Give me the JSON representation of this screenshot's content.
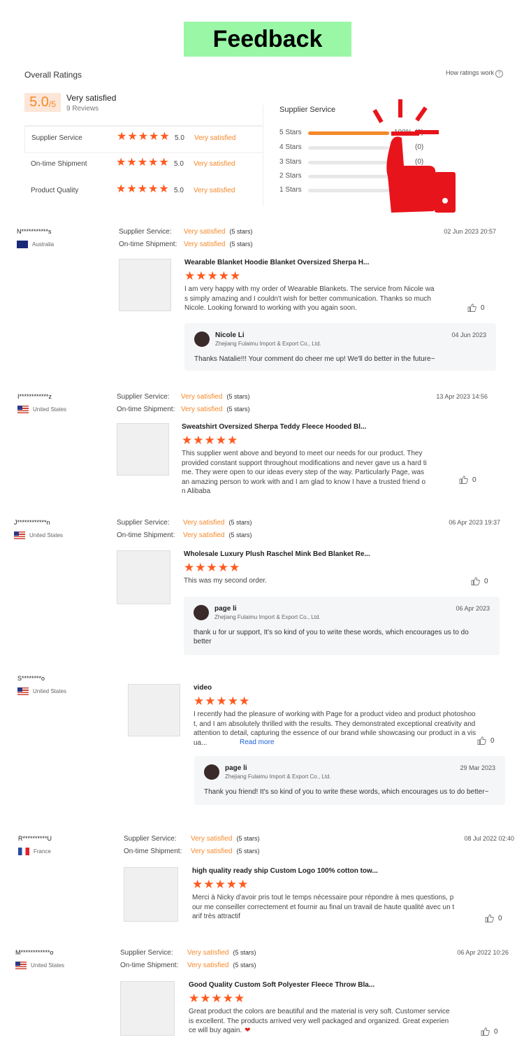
{
  "banner": "Feedback",
  "overall": {
    "title": "Overall Ratings",
    "how_link": "How ratings work",
    "score": "5.0",
    "score_den": "/5",
    "sat_label": "Very satisfied",
    "reviews": "9 Reviews",
    "rows": [
      {
        "label": "Supplier Service",
        "stars": 5,
        "value": "5.0",
        "text": "Very satisfied"
      },
      {
        "label": "On-time Shipment",
        "stars": 5,
        "value": "5.0",
        "text": "Very satisfied"
      },
      {
        "label": "Product Quality",
        "stars": 5,
        "value": "5.0",
        "text": "Very satisfied"
      }
    ]
  },
  "supplier_service": {
    "title": "Supplier Service",
    "bars": [
      {
        "label": "5 Stars",
        "fraction": 1.0,
        "pct": "100%",
        "count": "(9)"
      },
      {
        "label": "4 Stars",
        "fraction": 0,
        "pct": "",
        "count": "(0)"
      },
      {
        "label": "3 Stars",
        "fraction": 0,
        "pct": "",
        "count": "(0)"
      },
      {
        "label": "2 Stars",
        "fraction": 0,
        "pct": "",
        "count": ""
      },
      {
        "label": "1 Stars",
        "fraction": 0,
        "pct": "",
        "count": ""
      }
    ]
  },
  "labels": {
    "supplier_service": "Supplier Service:",
    "ontime": "On-time Shipment:",
    "very_satisfied": "Very satisfied",
    "five_stars": "(5 stars)",
    "read_more": "Read more",
    "like_count": "0",
    "company": "Zhejiang Fulaimu Import & Export Co., Ltd."
  },
  "reviews": [
    {
      "name": "N***********s",
      "country": "Australia",
      "date": "02 Jun 2023 20:57",
      "product": "Wearable Blanket Hoodie Blanket Oversized Sherpa H...",
      "text": "I am very happy with my order of Wearable Blankets.  The service from Nicole was simply amazing and I couldn't wish for better communication.  Thanks so much Nicole.  Looking forward to working with you again soon.",
      "reply": {
        "name": "Nicole Li",
        "date": "04 Jun 2023",
        "text": "Thanks Natalie!!! Your comment do cheer me up! We'll do better in the future~"
      }
    },
    {
      "name": "I************z",
      "country": "United States",
      "date": "13 Apr 2023 14:56",
      "product": "Sweatshirt Oversized Sherpa Teddy Fleece Hooded Bl...",
      "text": "This supplier went above and beyond to meet our needs for our product. They provided constant support throughout modifications and never gave us a hard time. They were open to our ideas every step of the way. Particularly Page, was an amazing person to work with and I am glad to know I have a trusted friend on Alibaba"
    },
    {
      "name": "J************n",
      "country": "United States",
      "date": "06 Apr 2023 19:37",
      "product": "Wholesale Luxury Plush Raschel Mink Bed Blanket Re...",
      "text": "This was my second order.",
      "reply": {
        "name": "page li",
        "date": "06 Apr 2023",
        "text": "thank u for ur support, It's so kind of you to write these words, which encourages us to do better"
      }
    },
    {
      "name": "S********o",
      "country": "United States",
      "date": "",
      "product": "video",
      "text": "I recently had the pleasure of working with Page for a product video and product photoshoot, and I am absolutely thrilled with the results. They demonstrated exceptional creativity and attention to detail, capturing the essence of our brand while showcasing our product in a visua...",
      "reply": {
        "name": "page li",
        "date": "29 Mar 2023",
        "text": "Thank you friend! It's so kind of you to write these words, which encourages us to do better~"
      }
    },
    {
      "name": "R**********U",
      "country": "France",
      "date": "08 Jul 2022 02:40",
      "product": "high quality ready ship Custom Logo 100% cotton tow...",
      "text": "Merci à Nicky d'avoir pris tout le temps nécessaire pour répondre à mes questions, pour me conseiller correctement et fournir au final un travail de haute qualité avec un tarif très attractif"
    },
    {
      "name": "M************o",
      "country": "United States",
      "date": "06 Apr 2022 10:26",
      "product": "Good Quality Custom Soft Polyester Fleece Throw Bla...",
      "text": "Great product the colors are beautiful and the material is very soft.  Customer service is excellent.  The products arrived very well packaged and organized.  Great experience will buy again.",
      "heart": "❤"
    }
  ]
}
